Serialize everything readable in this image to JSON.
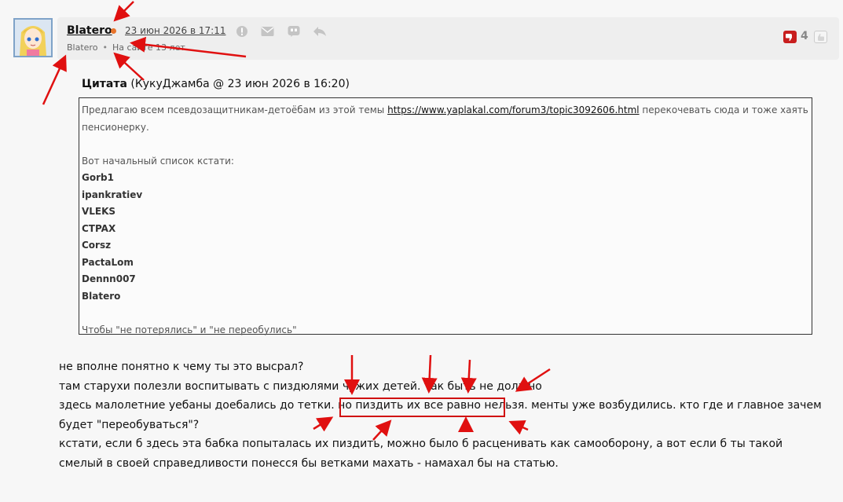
{
  "post": {
    "author": "Blatero",
    "date": "23 июн 2026 в 17:11",
    "status": "Blatero",
    "online_since": "На сайте 13 лет",
    "rating": "4",
    "colors": {
      "online": "#e8742c",
      "dislike": "#c81e1e",
      "annotation": "#e01010"
    }
  },
  "quote": {
    "label": "Цитата",
    "source": "(КукуДжамба @ 23 июн 2026 в 16:20)",
    "line1_before": "Предлагаю всем псевдозащитникам-детоёбам из этой темы ",
    "line1_link": "https://www.yaplakal.com/forum3/topic3092606.html",
    "line1_after": " перекочевать сюда и тоже хаять пенсионерку.",
    "list_intro": "Вот начальный список кстати:",
    "nicks": [
      "Gorb1",
      "ipankratiev",
      "VLEKS",
      "CTPAX",
      "Corsz",
      "PactaLom",
      "Dennn007",
      "Blatero"
    ],
    "closing": "Чтобы \"не потерялись\" и \"не переобулись\""
  },
  "body": {
    "line1": "не вполне понятно к чему ты это высрал?",
    "line2": "там старухи полезли воспитывать с пиздюлями чужих детей. так быть не должно",
    "line3_before": "здесь малолетние уебаны доебались до тетки. но ",
    "line3_highlight": "пиздить их все равно нельзя",
    "line3_after": ". менты уже возбудились. кто где и главное зачем будет \"переобуваться\"?",
    "line4": "кстати, если б здесь эта бабка попыталась их пиздить, можно было б расценивать как самооборону, а вот если б ты такой смелый в своей справедливости понесся бы ветками махать - намахал бы на статью."
  },
  "icons": [
    "avatar-image",
    "report-icon",
    "mail-icon",
    "quote-icon",
    "reply-icon",
    "dislike-icon",
    "like-icon",
    "annotation-arrow"
  ]
}
